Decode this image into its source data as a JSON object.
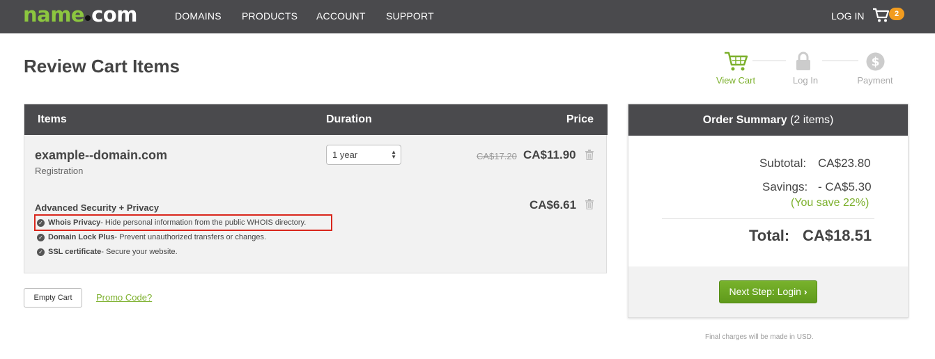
{
  "header": {
    "logo_part1": "name",
    "logo_part2": "com",
    "nav": [
      "DOMAINS",
      "PRODUCTS",
      "ACCOUNT",
      "SUPPORT"
    ],
    "login": "LOG IN",
    "cart_count": "2",
    "cart_icon": "cart-icon",
    "brand_green": "#8cc63f",
    "bar_color": "#4a4a4d",
    "badge_color": "#f29c1f"
  },
  "page": {
    "title": "Review Cart Items"
  },
  "steps": [
    {
      "label": "View Cart",
      "icon": "cart-icon",
      "active": true
    },
    {
      "label": "Log In",
      "icon": "lock-icon",
      "active": false
    },
    {
      "label": "Payment",
      "icon": "dollar-icon",
      "active": false
    }
  ],
  "cart": {
    "headers": {
      "items": "Items",
      "duration": "Duration",
      "price": "Price"
    },
    "domain": {
      "name": "example--domain.com",
      "type": "Registration",
      "duration": "1 year",
      "old_price": "CA$17.20",
      "price": "CA$11.90"
    },
    "addon": {
      "title": "Advanced Security + Privacy",
      "price": "CA$6.61",
      "features": [
        {
          "name": "Whois Privacy",
          "desc": " - Hide personal information from the public WHOIS directory."
        },
        {
          "name": "Domain Lock Plus",
          "desc": " - Prevent unauthorized transfers or changes."
        },
        {
          "name": "SSL certificate",
          "desc": " - Secure your website."
        }
      ]
    },
    "empty_cart": "Empty Cart",
    "promo": "Promo Code?"
  },
  "summary": {
    "title": "Order Summary",
    "count": " (2 items)",
    "subtotal_label": "Subtotal:",
    "subtotal": "CA$23.80",
    "savings_label": "Savings:",
    "savings": "- CA$5.30",
    "save_note": "(You save 22%)",
    "total_label": "Total:",
    "total": "CA$18.51",
    "next_button": "Next Step: Login",
    "final_note": "Final charges will be made in USD.",
    "accent": "#7cb02c"
  }
}
